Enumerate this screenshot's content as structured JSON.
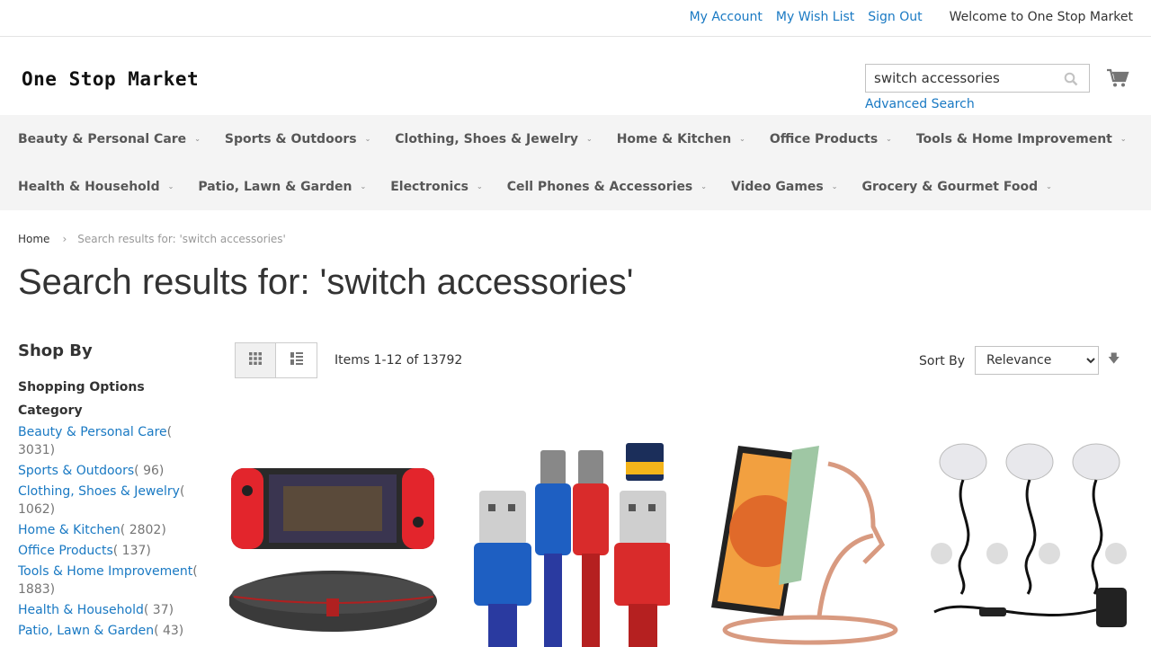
{
  "header": {
    "links": {
      "my_account": "My Account",
      "wish_list": "My Wish List",
      "sign_out": "Sign Out"
    },
    "welcome": "Welcome to One Stop Market",
    "logo_text": "One Stop Market",
    "search_value": "switch accessories",
    "advanced_search": "Advanced Search"
  },
  "nav": {
    "row1": [
      "Beauty & Personal Care",
      "Sports & Outdoors",
      "Clothing, Shoes & Jewelry",
      "Home & Kitchen",
      "Office Products",
      "Tools & Home Improvement"
    ],
    "row2": [
      "Health & Household",
      "Patio, Lawn & Garden",
      "Electronics",
      "Cell Phones & Accessories",
      "Video Games",
      "Grocery & Gourmet Food"
    ]
  },
  "breadcrumb": {
    "home": "Home",
    "current": "Search results for: 'switch accessories'"
  },
  "page_title": "Search results for: 'switch accessories'",
  "sidebar": {
    "shop_by": "Shop By",
    "shopping_options": "Shopping Options",
    "category_title": "Category",
    "categories": [
      {
        "name": "Beauty & Personal Care",
        "count": "( 3031)"
      },
      {
        "name": "Sports & Outdoors",
        "count": "( 96)"
      },
      {
        "name": "Clothing, Shoes & Jewelry",
        "count": "( 1062)"
      },
      {
        "name": "Home & Kitchen",
        "count": "( 2802)"
      },
      {
        "name": "Office Products",
        "count": "( 137)"
      },
      {
        "name": "Tools & Home Improvement",
        "count": "( 1883)"
      },
      {
        "name": "Health & Household",
        "count": "( 37)"
      },
      {
        "name": "Patio, Lawn & Garden",
        "count": "( 43)"
      }
    ]
  },
  "toolbar": {
    "items_text": "Items 1-12 of 13792",
    "sort_label": "Sort By",
    "sort_selected": "Relevance"
  },
  "colors": {
    "link": "#1979c3",
    "nav_bg": "#f4f4f4"
  }
}
